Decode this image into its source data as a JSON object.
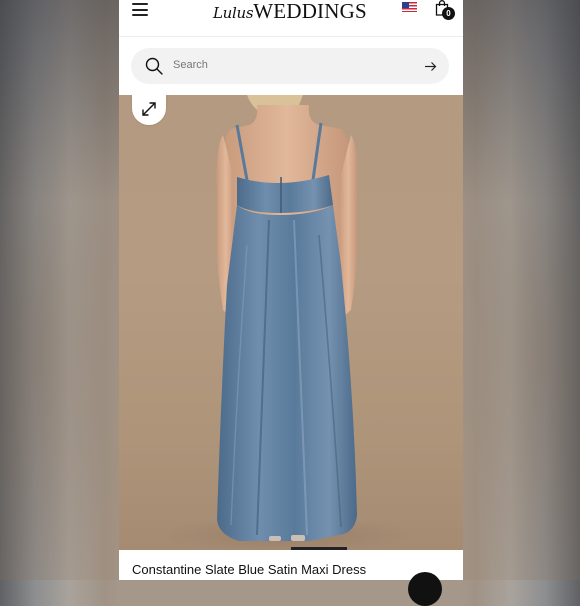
{
  "header": {
    "brand_script": "Lulus",
    "brand_main": "WEDDINGS",
    "bag_count": "0"
  },
  "search": {
    "placeholder": "Search"
  },
  "product": {
    "title": "Constantine Slate Blue Satin Maxi Dress",
    "dress_color": "#5a7a9b",
    "backdrop_color": "#b39a80"
  },
  "icons": {
    "menu": "hamburger-menu-icon",
    "flag": "us-flag-icon",
    "bag": "shopping-bag-icon",
    "search": "search-icon",
    "submit": "arrow-right-icon",
    "expand": "expand-icon"
  }
}
